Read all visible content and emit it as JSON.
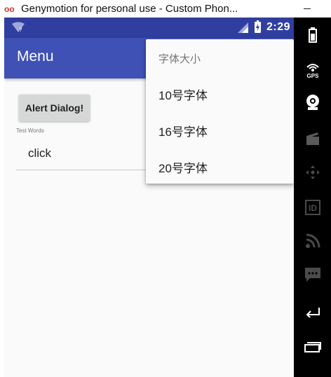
{
  "window": {
    "title": "Genymotion for personal use - Custom Phon...",
    "logo_text": "oo"
  },
  "status_bar": {
    "time": "2:29",
    "background": "#303f9f"
  },
  "app_bar": {
    "title": "Menu",
    "background": "#3f51b5"
  },
  "content": {
    "alert_button_label": "Alert Dialog!",
    "field_label": "Test Words",
    "field_value": "click"
  },
  "popup_menu": {
    "header": "字体大小",
    "items": [
      {
        "label": "10号字体"
      },
      {
        "label": "16号字体"
      },
      {
        "label": "20号字体"
      }
    ]
  },
  "sidebar": {
    "gps_label": "GPS",
    "id_label": "ID",
    "icons": [
      "battery-icon",
      "gps-icon",
      "camera-icon",
      "clapperboard-icon",
      "dpad-icon",
      "id-icon",
      "rss-icon",
      "sms-icon",
      "back-icon",
      "recent-apps-icon"
    ]
  }
}
